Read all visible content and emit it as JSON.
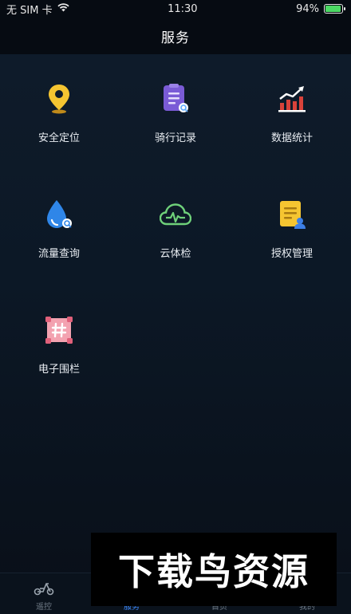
{
  "status_bar": {
    "carrier": "无 SIM 卡",
    "time": "11:30",
    "battery": "94%",
    "battery_level": 0.94
  },
  "header": {
    "title": "服务"
  },
  "services": [
    {
      "label": "安全定位",
      "icon": "location-pin-icon"
    },
    {
      "label": "骑行记录",
      "icon": "ride-record-icon"
    },
    {
      "label": "数据统计",
      "icon": "statistics-icon"
    },
    {
      "label": "流量查询",
      "icon": "data-usage-icon"
    },
    {
      "label": "云体检",
      "icon": "cloud-check-icon"
    },
    {
      "label": "授权管理",
      "icon": "authorization-icon"
    },
    {
      "label": "电子围栏",
      "icon": "geofence-icon"
    }
  ],
  "tabs": [
    {
      "label": "遥控",
      "icon": "scooter-icon",
      "active": false
    },
    {
      "label": "服务",
      "icon": "service-icon",
      "active": true
    },
    {
      "label": "首页",
      "icon": "home-icon",
      "active": false
    },
    {
      "label": "我的",
      "icon": "profile-icon",
      "active": false
    }
  ],
  "watermark": {
    "text": "下载鸟资源"
  },
  "colors": {
    "accent": "#3d8bff",
    "background": "#0c1826",
    "tab_inactive": "#6f7a86"
  }
}
